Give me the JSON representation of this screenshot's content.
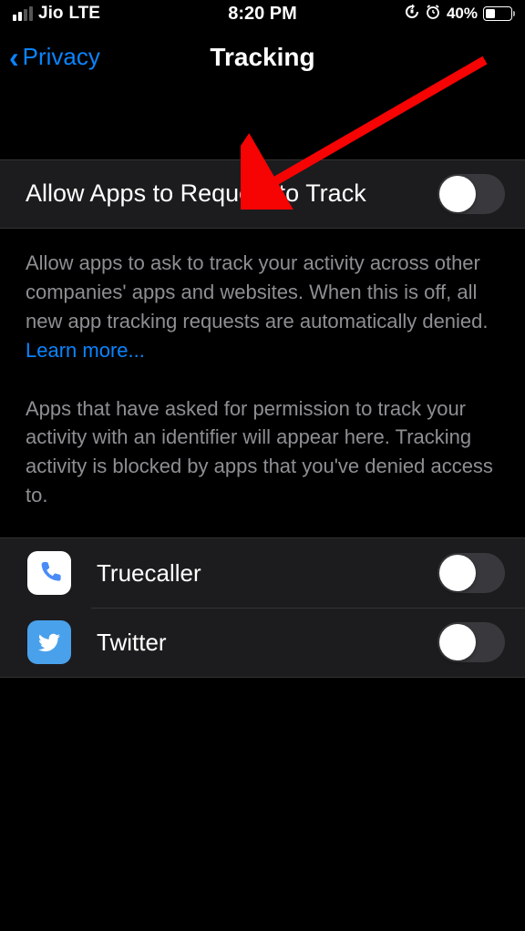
{
  "status_bar": {
    "carrier": "Jio",
    "network": "LTE",
    "time": "8:20 PM",
    "battery_percent": "40%"
  },
  "nav": {
    "back_label": "Privacy",
    "title": "Tracking"
  },
  "main_toggle": {
    "label": "Allow Apps to Request to Track",
    "on": false
  },
  "footer1": {
    "text": "Allow apps to ask to track your activity across other companies' apps and websites. When this is off, all new app tracking requests are automatically denied. ",
    "link": "Learn more..."
  },
  "footer2": {
    "text": "Apps that have asked for permission to track your activity with an identifier will appear here. Tracking activity is blocked by apps that you've denied access to."
  },
  "apps": [
    {
      "name": "Truecaller",
      "on": false,
      "icon": "phone"
    },
    {
      "name": "Twitter",
      "on": false,
      "icon": "bird"
    }
  ]
}
